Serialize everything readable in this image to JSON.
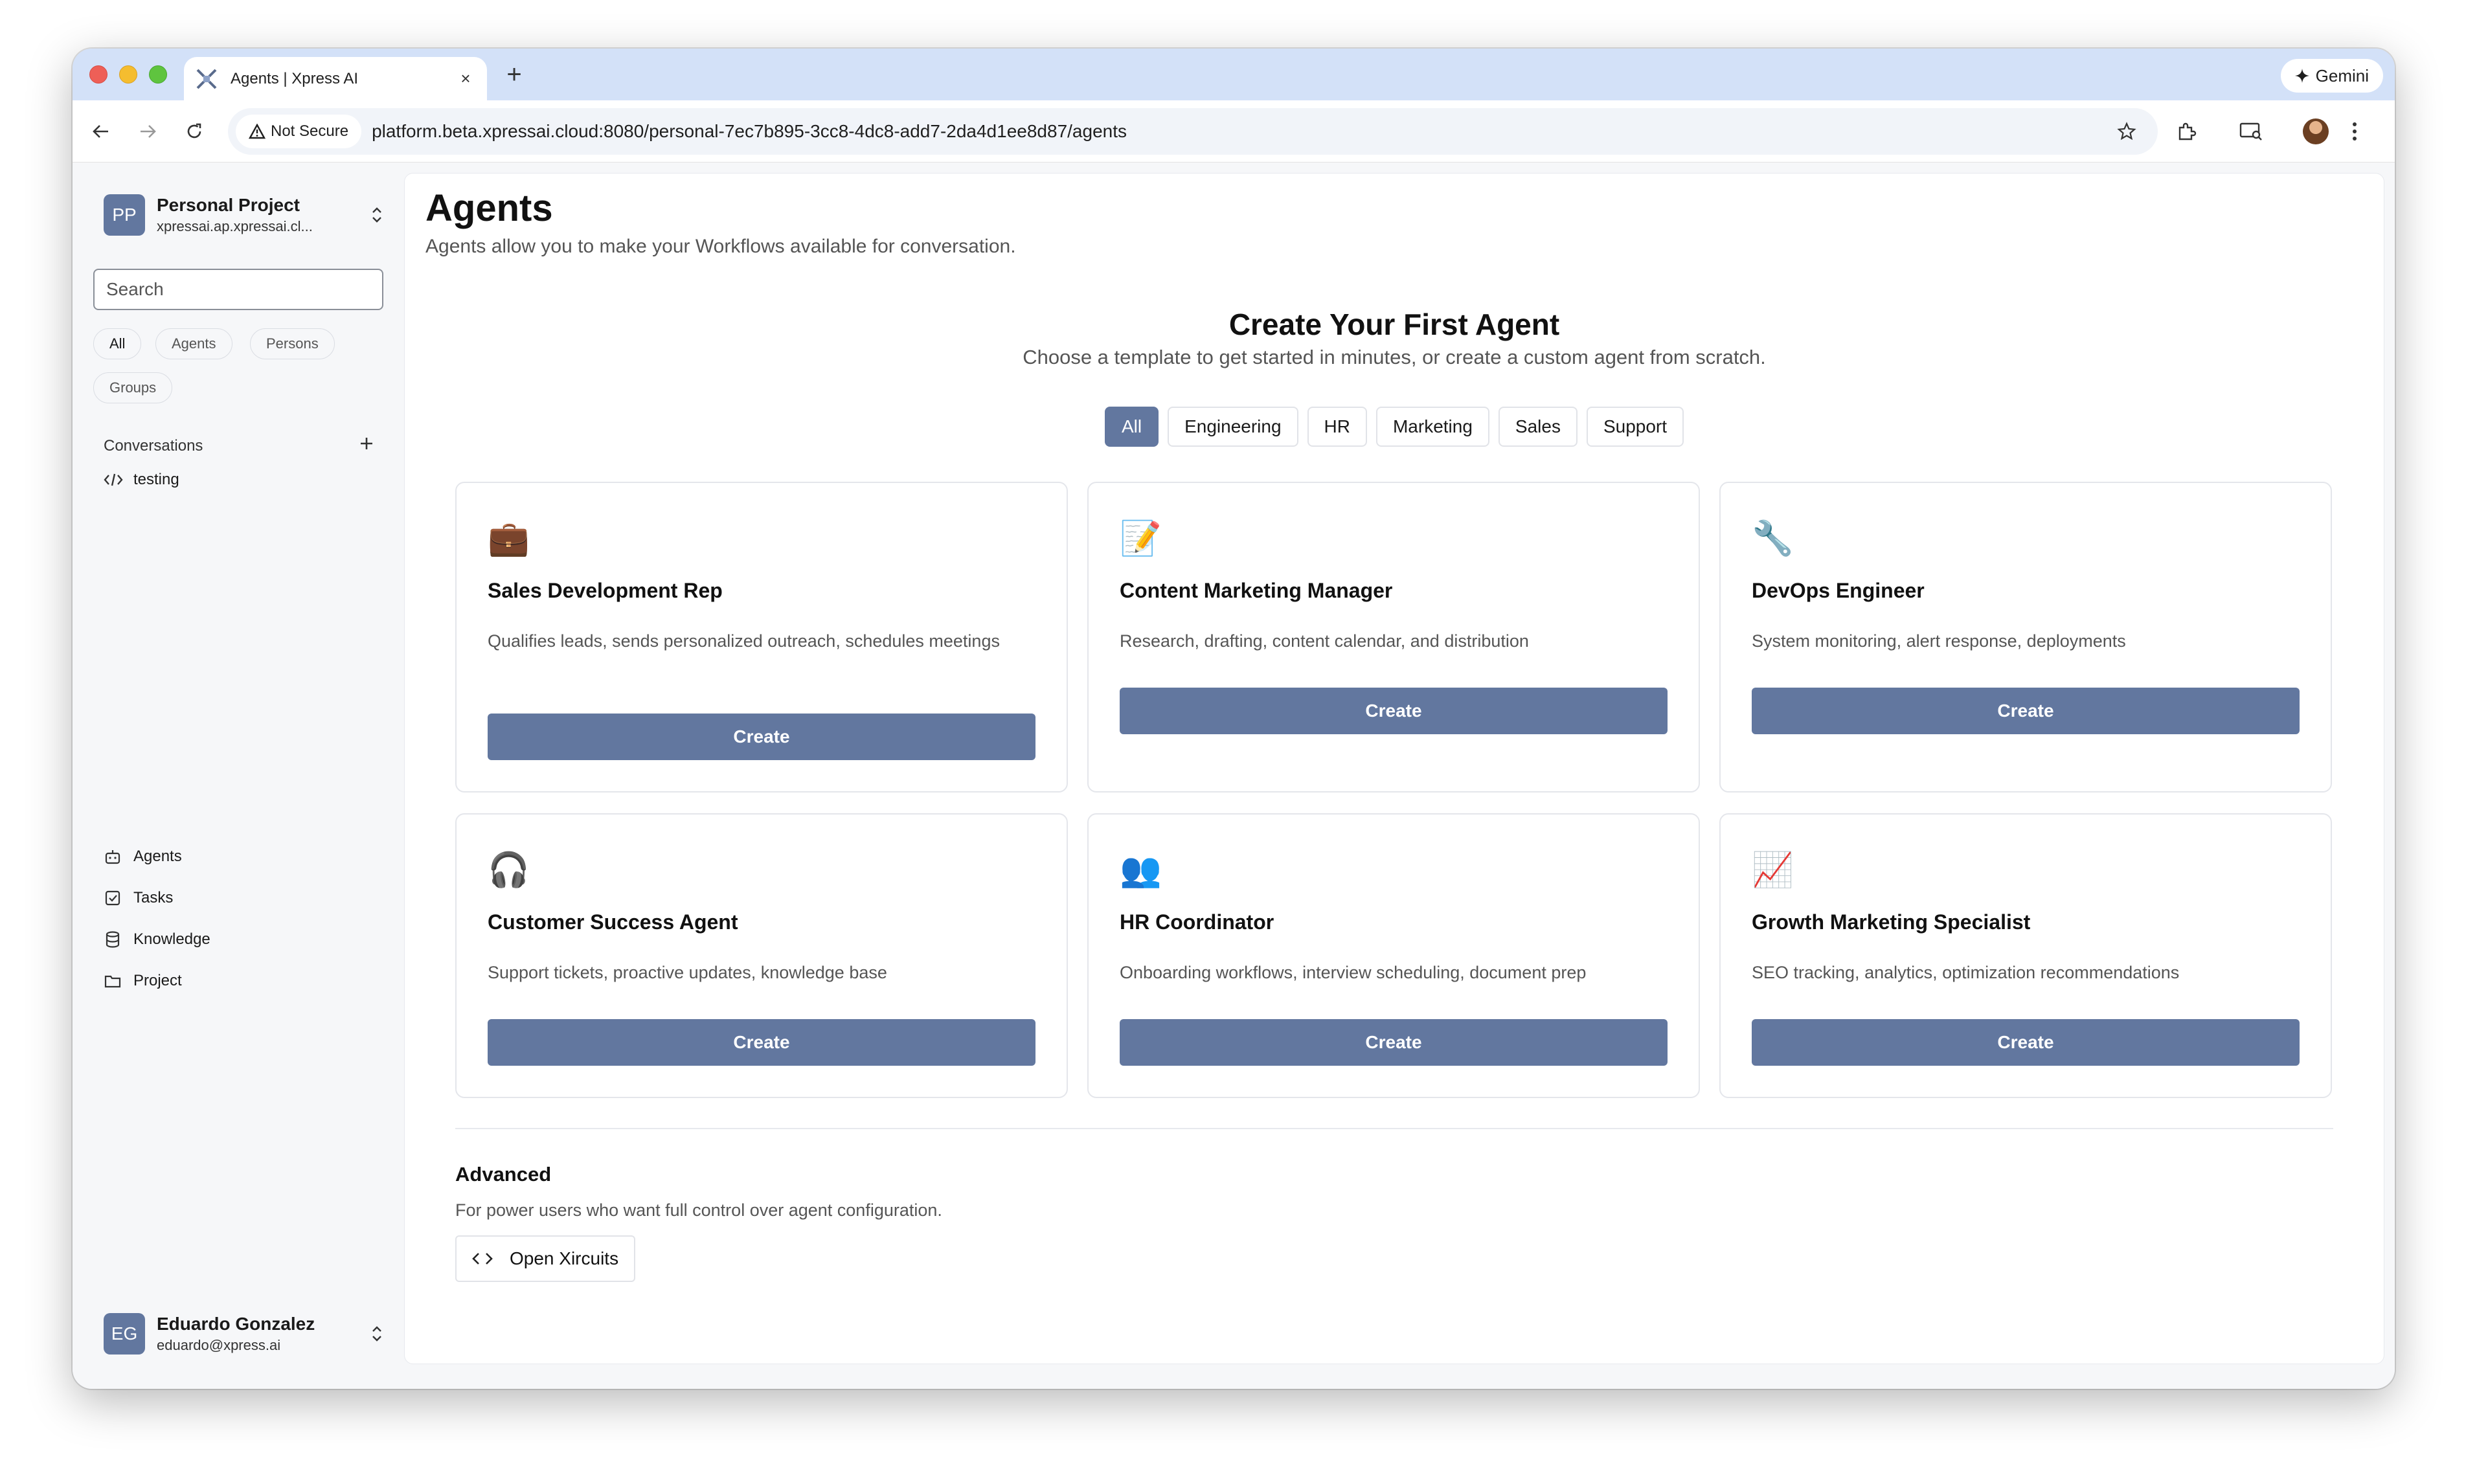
{
  "browser": {
    "tab_title": "Agents | Xpress AI",
    "new_tab": "+",
    "tab_close": "×",
    "gemini_label": "Gemini",
    "security_label": "Not Secure",
    "url": "platform.beta.xpressai.cloud:8080/personal-7ec7b895-3cc8-4dc8-add7-2da4d1ee8d87/agents"
  },
  "sidebar": {
    "project": {
      "initials": "PP",
      "name": "Personal Project",
      "subtitle": "xpressai.ap.xpressai.cl..."
    },
    "search_placeholder": "Search",
    "filters": [
      "All",
      "Agents",
      "Persons",
      "Groups"
    ],
    "conversations_label": "Conversations",
    "conversations": [
      {
        "label": "testing",
        "icon": "code-icon"
      }
    ],
    "nav": [
      {
        "label": "Agents",
        "icon": "bot-icon"
      },
      {
        "label": "Tasks",
        "icon": "checkbox-icon"
      },
      {
        "label": "Knowledge",
        "icon": "database-icon"
      },
      {
        "label": "Project",
        "icon": "folder-icon"
      }
    ],
    "user": {
      "initials": "EG",
      "name": "Eduardo Gonzalez",
      "email": "eduardo@xpress.ai"
    }
  },
  "main": {
    "title": "Agents",
    "subtitle": "Agents allow you to make your Workflows available for conversation.",
    "hero_title": "Create Your First Agent",
    "hero_subtitle": "Choose a template to get started in minutes, or create a custom agent from scratch.",
    "categories": [
      "All",
      "Engineering",
      "HR",
      "Marketing",
      "Sales",
      "Support"
    ],
    "active_category": "All",
    "templates": [
      {
        "emoji": "💼",
        "title": "Sales Development Rep",
        "description": "Qualifies leads, sends personalized outreach, schedules meetings",
        "button": "Create"
      },
      {
        "emoji": "📝",
        "title": "Content Marketing Manager",
        "description": "Research, drafting, content calendar, and distribution",
        "button": "Create"
      },
      {
        "emoji": "🔧",
        "title": "DevOps Engineer",
        "description": "System monitoring, alert response, deployments",
        "button": "Create"
      },
      {
        "emoji": "🎧",
        "title": "Customer Success Agent",
        "description": "Support tickets, proactive updates, knowledge base",
        "button": "Create"
      },
      {
        "emoji": "👥",
        "title": "HR Coordinator",
        "description": "Onboarding workflows, interview scheduling, document prep",
        "button": "Create"
      },
      {
        "emoji": "📈",
        "title": "Growth Marketing Specialist",
        "description": "SEO tracking, analytics, optimization recommendations",
        "button": "Create"
      }
    ],
    "advanced": {
      "title": "Advanced",
      "subtitle": "For power users who want full control over agent configuration.",
      "button": "Open Xircuits"
    }
  },
  "colors": {
    "accent": "#62779f",
    "tabstrip": "#d3e1f8"
  }
}
